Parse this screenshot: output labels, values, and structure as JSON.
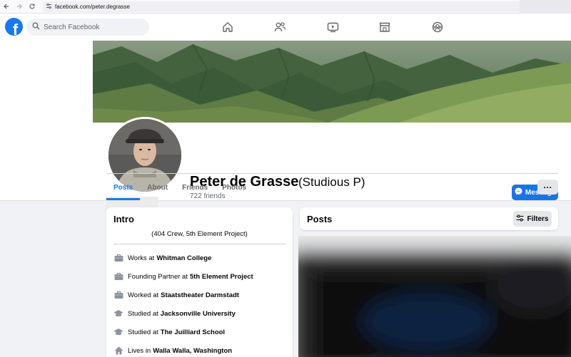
{
  "browser": {
    "url": "facebook.com/peter.degrasse"
  },
  "nav": {
    "logo": "f",
    "search_placeholder": "Search Facebook"
  },
  "profile": {
    "name": "Peter de Grasse",
    "alternate_name": "(Studious P)",
    "friends": "722 friends",
    "message_label": "Message",
    "more_label": "···"
  },
  "tabs": [
    {
      "label": "Posts",
      "active": true
    },
    {
      "label": "About",
      "active": false
    },
    {
      "label": "Friends",
      "active": false
    },
    {
      "label": "Photos",
      "active": false
    }
  ],
  "intro": {
    "title": "Intro",
    "bio": "(404 Crew, 5th Element Project)",
    "items": [
      {
        "icon": "briefcase-icon",
        "prefix": "Works at",
        "value": "Whitman College"
      },
      {
        "icon": "briefcase-icon",
        "prefix": "Founding Partner at",
        "value": "5th Element Project"
      },
      {
        "icon": "briefcase-icon",
        "prefix": "Worked at",
        "value": "Staatstheater Darmstadt"
      },
      {
        "icon": "graduation-cap-icon",
        "prefix": "Studied at",
        "value": "Jacksonville University"
      },
      {
        "icon": "graduation-cap-icon",
        "prefix": "Studied at",
        "value": "The Juilliard School"
      },
      {
        "icon": "home-icon",
        "prefix": "Lives in",
        "value": "Walla Walla, Washington"
      }
    ]
  },
  "posts": {
    "title": "Posts",
    "filters_label": "Filters"
  },
  "colors": {
    "brand": "#1877f2",
    "button_blue": "#1b74e4",
    "page_bg": "#f0f2f5"
  }
}
